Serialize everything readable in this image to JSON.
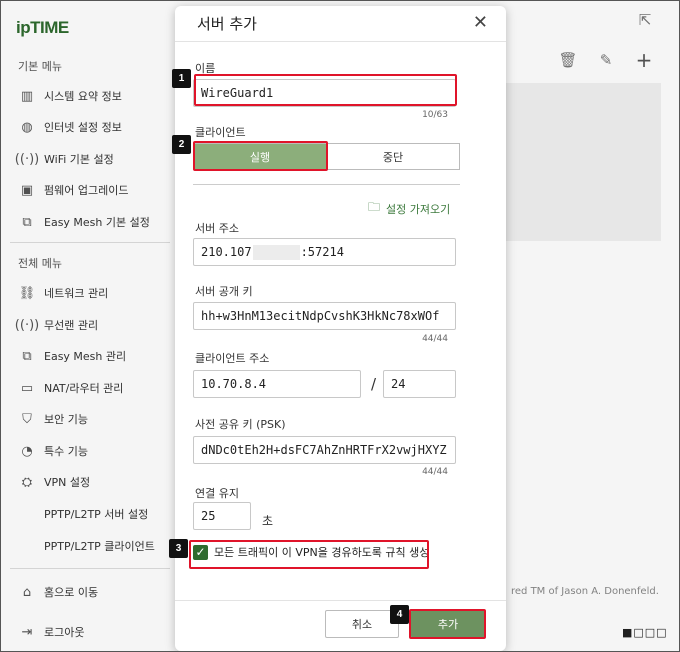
{
  "sidebar": {
    "logo": "ipTIME",
    "section_basic": "기본 메뉴",
    "basic_items": [
      {
        "label": "시스템 요약 정보",
        "icon": "chart-bars-icon"
      },
      {
        "label": "인터넷 설정 정보",
        "icon": "globe-icon"
      },
      {
        "label": "WiFi 기본 설정",
        "icon": "wifi-icon"
      },
      {
        "label": "펌웨어 업그레이드",
        "icon": "upgrade-icon"
      },
      {
        "label": "Easy Mesh 기본 설정",
        "icon": "mesh-icon"
      }
    ],
    "section_all": "전체 메뉴",
    "all_items": [
      {
        "label": "네트워크 관리",
        "icon": "network-icon"
      },
      {
        "label": "무선랜 관리",
        "icon": "wireless-icon"
      },
      {
        "label": "Easy Mesh 관리",
        "icon": "mesh-icon"
      },
      {
        "label": "NAT/라우터 관리",
        "icon": "router-icon"
      },
      {
        "label": "보안 기능",
        "icon": "shield-icon"
      },
      {
        "label": "특수 기능",
        "icon": "special-icon"
      },
      {
        "label": "VPN 설정",
        "icon": "vpn-icon"
      }
    ],
    "vpn_sub": [
      "PPTP/L2TP 서버 설정",
      "PPTP/L2TP 클라이언트"
    ],
    "home": "홈으로 이동",
    "logout": "로그아웃"
  },
  "background": {
    "footer_text": "red TM of Jason A. Donenfeld.",
    "dots": "■□□□"
  },
  "modal": {
    "title": "서버 추가",
    "name_label": "이름",
    "name_value": "WireGuard1",
    "name_counter": "10/63",
    "client_label": "클라이언트",
    "run_label": "실행",
    "stop_label": "중단",
    "fetch_label": "설정 가져오기",
    "server_addr_label": "서버 주소",
    "server_addr_prefix": "210.107",
    "server_addr_suffix": ":57214",
    "pubkey_label": "서버 공개 키",
    "pubkey_value": "hh+w3HnM13ecitNdpCvshK3HkNc78xWOf",
    "pubkey_counter": "44/44",
    "client_addr_label": "클라이언트 주소",
    "client_addr_value": "10.70.8.4",
    "client_mask_value": "24",
    "slash": "/",
    "psk_label": "사전 공유 키 (PSK)",
    "psk_value": "dNDc0tEh2H+dsFC7AhZnHRTFrX2vwjHXYZ",
    "psk_counter": "44/44",
    "keepalive_label": "연결 유지",
    "keepalive_value": "25",
    "keepalive_unit": "초",
    "route_all_label": "모든 트래픽이 이 VPN을 경유하도록 규칙 생성",
    "route_all_checked": true,
    "cancel_label": "취소",
    "add_label": "추가"
  },
  "annotations": [
    "1",
    "2",
    "3",
    "4"
  ],
  "colors": {
    "accent_green": "#6d9260",
    "active_segment": "#8cae7b",
    "highlight_red": "#e0142a"
  }
}
